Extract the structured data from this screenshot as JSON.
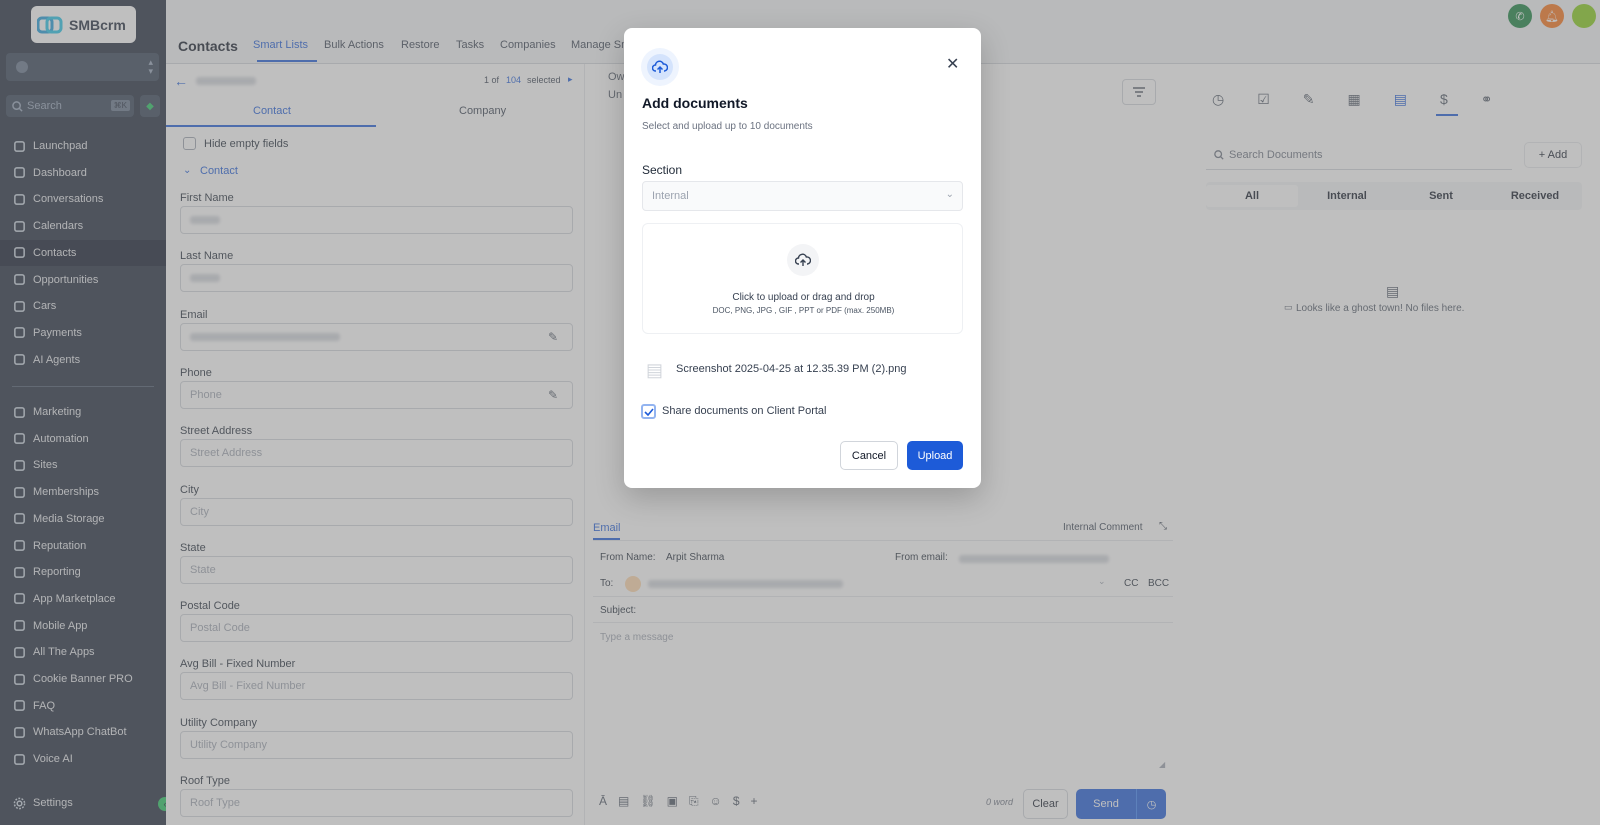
{
  "brand": {
    "logo_text": "SMBcrm"
  },
  "sidebar": {
    "search_placeholder": "Search",
    "search_shortcut": "⌘K",
    "items": [
      {
        "label": "Launchpad",
        "icon": "rocket-icon"
      },
      {
        "label": "Dashboard",
        "icon": "dashboard-icon"
      },
      {
        "label": "Conversations",
        "icon": "chat-icon"
      },
      {
        "label": "Calendars",
        "icon": "calendar-icon"
      },
      {
        "label": "Contacts",
        "icon": "contacts-icon"
      },
      {
        "label": "Opportunities",
        "icon": "opportunities-icon"
      },
      {
        "label": "Cars",
        "icon": "car-icon"
      },
      {
        "label": "Payments",
        "icon": "payments-icon"
      },
      {
        "label": "AI Agents",
        "icon": "ai-agents-icon"
      }
    ],
    "items2": [
      {
        "label": "Marketing",
        "icon": "send-icon"
      },
      {
        "label": "Automation",
        "icon": "automation-icon"
      },
      {
        "label": "Sites",
        "icon": "sites-icon"
      },
      {
        "label": "Memberships",
        "icon": "memberships-icon"
      },
      {
        "label": "Media Storage",
        "icon": "image-icon"
      },
      {
        "label": "Reputation",
        "icon": "star-icon"
      },
      {
        "label": "Reporting",
        "icon": "trend-icon"
      },
      {
        "label": "App Marketplace",
        "icon": "grid-icon"
      },
      {
        "label": "Mobile App",
        "icon": "mobile-icon"
      },
      {
        "label": "All The Apps",
        "icon": "apps-icon"
      },
      {
        "label": "Cookie Banner PRO",
        "icon": "cookie-icon"
      },
      {
        "label": "FAQ",
        "icon": "question-icon"
      },
      {
        "label": "WhatsApp ChatBot",
        "icon": "whatsapp-icon"
      },
      {
        "label": "Voice AI",
        "icon": "phone-icon"
      }
    ],
    "settings_label": "Settings"
  },
  "topnav": {
    "title": "Contacts",
    "tabs": [
      "Smart Lists",
      "Bulk Actions",
      "Restore",
      "Tasks",
      "Companies",
      "Manage Sm"
    ]
  },
  "contact_panel": {
    "pager_of": "1 of",
    "pager_total": "104",
    "pager_selected": "selected",
    "tab_contact": "Contact",
    "tab_company": "Company",
    "hide_empty": "Hide empty fields",
    "section": "Contact",
    "fields": [
      {
        "label": "First Name",
        "placeholder": ""
      },
      {
        "label": "Last Name",
        "placeholder": ""
      },
      {
        "label": "Email",
        "placeholder": ""
      },
      {
        "label": "Phone",
        "placeholder": "Phone"
      },
      {
        "label": "Street Address",
        "placeholder": "Street Address"
      },
      {
        "label": "City",
        "placeholder": "City"
      },
      {
        "label": "State",
        "placeholder": "State"
      },
      {
        "label": "Postal Code",
        "placeholder": "Postal Code"
      },
      {
        "label": "Avg Bill - Fixed Number",
        "placeholder": "Avg Bill - Fixed Number"
      },
      {
        "label": "Utility Company",
        "placeholder": "Utility Company"
      },
      {
        "label": "Roof Type",
        "placeholder": "Roof Type"
      }
    ]
  },
  "middle": {
    "owner_partial": "Ow",
    "un_partial": "Un"
  },
  "composer": {
    "tab_email": "Email",
    "internal_comment": "Internal Comment",
    "from_name_label": "From Name:",
    "from_name_value": "Arpit Sharma",
    "from_email_label": "From email:",
    "to_label": "To:",
    "cc": "CC",
    "bcc": "BCC",
    "subject_label": "Subject:",
    "message_placeholder": "Type a message",
    "word_count": "0 word",
    "clear": "Clear",
    "send": "Send"
  },
  "documents": {
    "search_placeholder": "Search Documents",
    "add": "+ Add",
    "filters": [
      "All",
      "Internal",
      "Sent",
      "Received"
    ],
    "empty_text": "Looks like a ghost town! No files here."
  },
  "modal": {
    "title": "Add documents",
    "subtitle": "Select and upload up to 10 documents",
    "section_label": "Section",
    "section_value": "Internal",
    "dropzone_title": "Click to upload or drag and drop",
    "dropzone_formats": "DOC, PNG, JPG , GIF , PPT or PDF (max. 250MB)",
    "file_name": "Screenshot 2025-04-25 at 12.35.39 PM (2).png",
    "share_label": "Share documents on Client Portal",
    "share_checked": true,
    "cancel": "Cancel",
    "upload": "Upload"
  },
  "colors": {
    "primary": "#1d5bd8",
    "sidebar_bg": "#1e293b",
    "accent_green": "#16a34a",
    "accent_orange": "#f97316"
  }
}
